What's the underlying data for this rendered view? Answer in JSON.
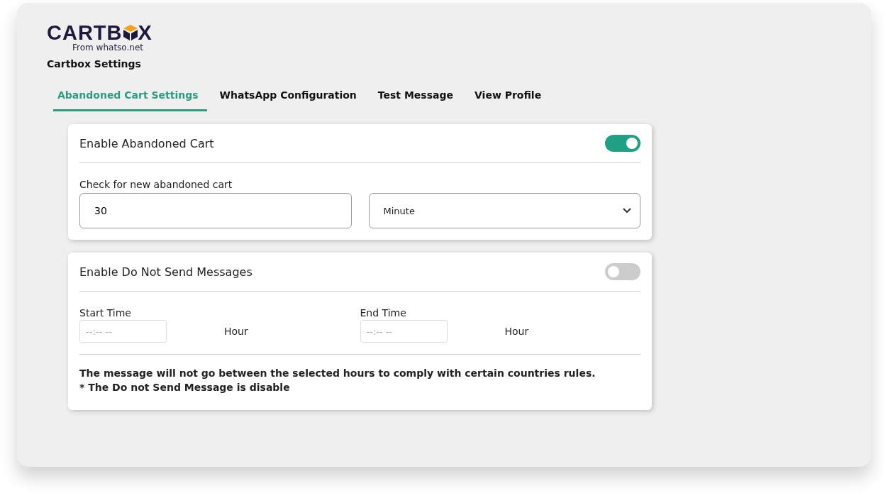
{
  "logo": {
    "text_before": "CARTB",
    "text_after": "X",
    "tagline": "From whatso.net"
  },
  "page_title": "Cartbox Settings",
  "tabs": [
    {
      "label": "Abandoned Cart Settings",
      "selected": true
    },
    {
      "label": "WhatsApp Configuration",
      "selected": false
    },
    {
      "label": "Test Message",
      "selected": false
    },
    {
      "label": "View Profile",
      "selected": false
    }
  ],
  "abandoned_cart": {
    "title": "Enable Abandoned Cart",
    "on": true,
    "field_label": "Check for new abandoned cart",
    "interval_value": "30",
    "interval_unit": "Minute"
  },
  "do_not_send": {
    "title": "Enable Do Not Send Messages",
    "on": false,
    "times": [
      {
        "label": "Start Time",
        "placeholder": "--:-- --",
        "unit": "Hour"
      },
      {
        "label": "End Time",
        "placeholder": "--:-- --",
        "unit": "Hour"
      }
    ],
    "notes": [
      "The message will not go between the selected hours to comply with certain countries rules.",
      "* The Do not Send Message is disable"
    ]
  }
}
